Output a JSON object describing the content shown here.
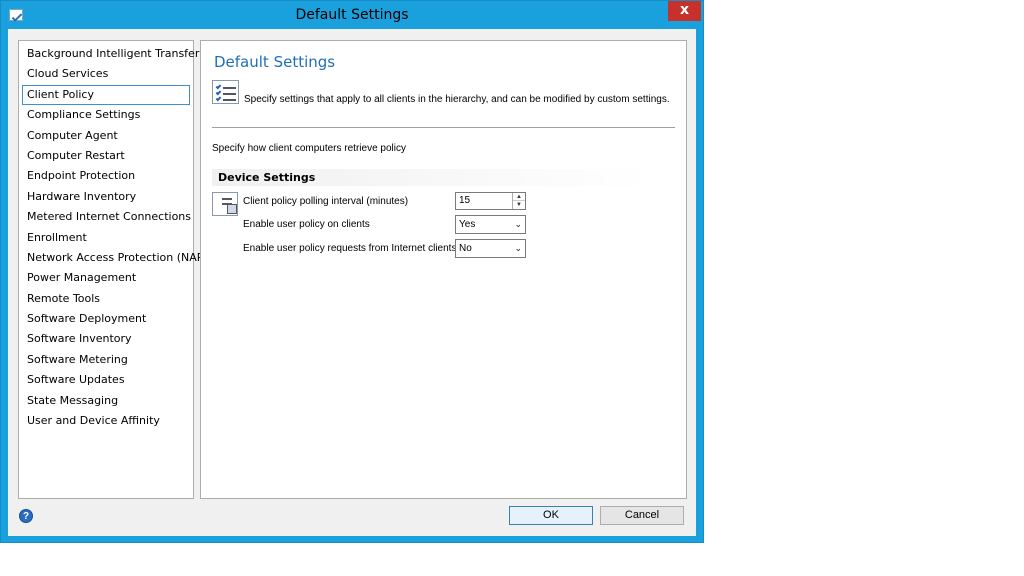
{
  "window": {
    "title": "Default Settings",
    "close_label": "x"
  },
  "nav": {
    "items": [
      {
        "label": "Background Intelligent Transfer"
      },
      {
        "label": "Cloud Services"
      },
      {
        "label": "Client Policy",
        "selected": true
      },
      {
        "label": "Compliance Settings"
      },
      {
        "label": "Computer Agent"
      },
      {
        "label": "Computer Restart"
      },
      {
        "label": "Endpoint Protection"
      },
      {
        "label": "Hardware Inventory"
      },
      {
        "label": "Metered Internet Connections"
      },
      {
        "label": "Enrollment"
      },
      {
        "label": "Network Access Protection (NAP)"
      },
      {
        "label": "Power Management"
      },
      {
        "label": "Remote Tools"
      },
      {
        "label": "Software Deployment"
      },
      {
        "label": "Software Inventory"
      },
      {
        "label": "Software Metering"
      },
      {
        "label": "Software Updates"
      },
      {
        "label": "State Messaging"
      },
      {
        "label": "User and Device Affinity"
      }
    ]
  },
  "content": {
    "title": "Default Settings",
    "description": "Specify settings that apply to all clients in the hierarchy, and can be modified by custom settings.",
    "instruction": "Specify how client computers retrieve policy",
    "group_title": "Device Settings",
    "settings": {
      "polling_label": "Client policy polling interval (minutes)",
      "polling_value": "15",
      "user_policy_label": "Enable user policy on clients",
      "user_policy_value": "Yes",
      "internet_label": "Enable user policy requests from Internet clients",
      "internet_value": "No"
    }
  },
  "footer": {
    "help_label": "?",
    "ok_label": "OK",
    "cancel_label": "Cancel"
  },
  "icons": {
    "app": "checklist-icon",
    "header": "checklist-icon",
    "device": "device-settings-icon",
    "help": "help-icon"
  },
  "colors": {
    "window_frame": "#1aa0dc",
    "close_button": "#c7312c",
    "title_accent": "#1e6fb8",
    "selection_border": "#3e8ed0"
  }
}
